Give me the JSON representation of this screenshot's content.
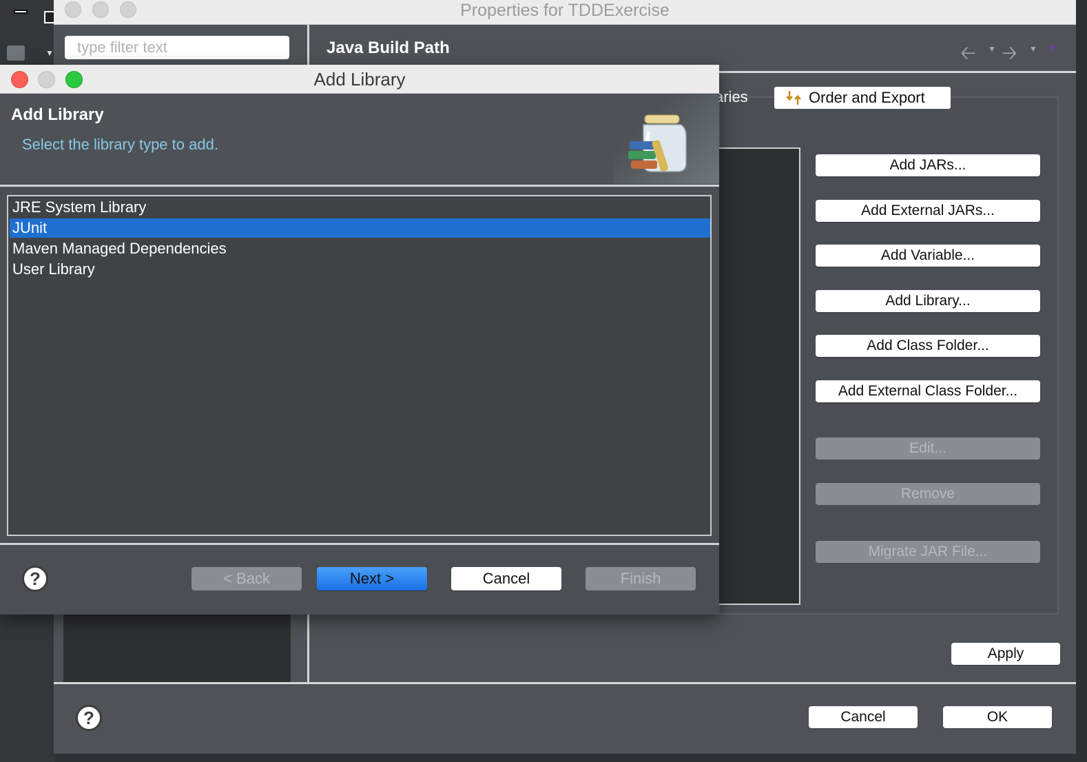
{
  "properties_window": {
    "title": "Properties for TDDExercise",
    "filter_placeholder": "type filter text",
    "page_title": "Java Build Path",
    "tabs": {
      "partial_label": "aries",
      "active_label": "Order and Export"
    },
    "side_buttons": [
      {
        "label": "Add JARs...",
        "enabled": true
      },
      {
        "label": "Add External JARs...",
        "enabled": true
      },
      {
        "label": "Add Variable...",
        "enabled": true
      },
      {
        "label": "Add Library...",
        "enabled": true
      },
      {
        "label": "Add Class Folder...",
        "enabled": true
      },
      {
        "label": "Add External Class Folder...",
        "enabled": true
      },
      {
        "label": "Edit...",
        "enabled": false
      },
      {
        "label": "Remove",
        "enabled": false
      },
      {
        "label": "Migrate JAR File...",
        "enabled": false
      }
    ],
    "apply_label": "Apply",
    "cancel_label": "Cancel",
    "ok_label": "OK",
    "help_glyph": "?"
  },
  "add_library_dialog": {
    "title": "Add Library",
    "heading": "Add Library",
    "subtitle": "Select the library type to add.",
    "library_types": [
      {
        "label": "JRE System Library",
        "selected": false
      },
      {
        "label": "JUnit",
        "selected": true
      },
      {
        "label": "Maven Managed Dependencies",
        "selected": false
      },
      {
        "label": "User Library",
        "selected": false
      }
    ],
    "buttons": {
      "back": "< Back",
      "next": "Next >",
      "cancel": "Cancel",
      "finish": "Finish"
    },
    "help_glyph": "?"
  },
  "colors": {
    "selection": "#1f6fd0",
    "subtitle": "#87c8e6",
    "panel_bg": "#4f5357"
  }
}
